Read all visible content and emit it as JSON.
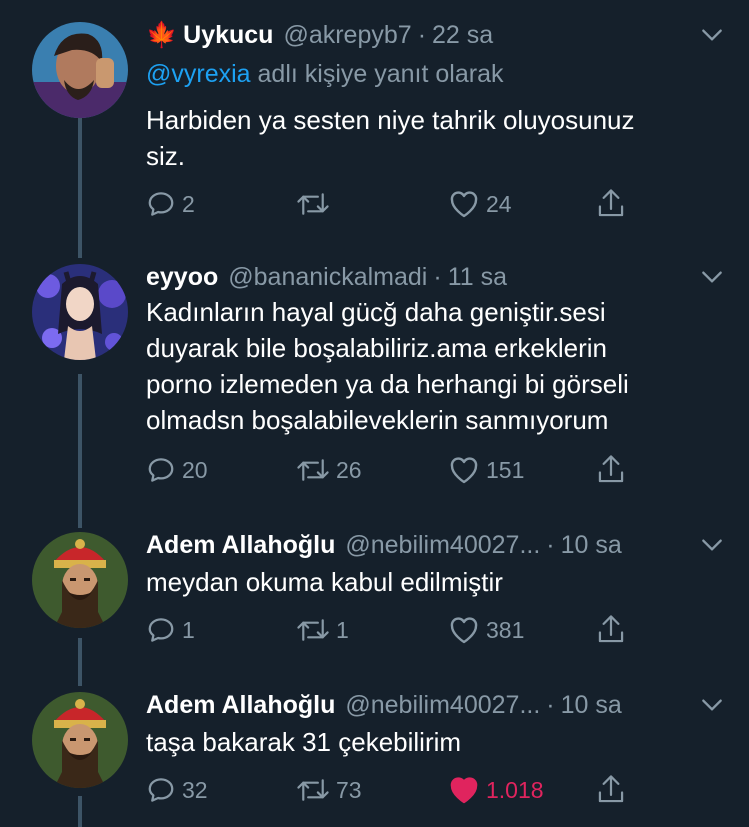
{
  "colors": {
    "background": "#15202b",
    "muted": "#8899a6",
    "link": "#1da1f2",
    "like": "#e0245e"
  },
  "tweets": [
    {
      "emoji": "🍁",
      "name": "Uykucu",
      "handle": "@akrepyb7",
      "time": "22 sa",
      "reply_to": {
        "mention": "@vyrexia",
        "suffix": " adlı kişiye yanıt olarak"
      },
      "text_lines": [
        "Harbiden ya sesten niye tahrik oluyosunuz",
        "siz."
      ],
      "replies": "2",
      "retweets": "",
      "likes": "24",
      "liked": false
    },
    {
      "name": "eyyoo",
      "handle": "@bananickalmadi",
      "time": "11 sa",
      "text_lines": [
        "Kadınların hayal gücğ daha geniştir.sesi",
        "duyarak bile boşalabiliriz.ama erkeklerin",
        "porno izlemeden ya da herhangi bi görseli",
        "olmadsn boşalabileveklerin sanmıyorum"
      ],
      "replies": "20",
      "retweets": "26",
      "likes": "151",
      "liked": false
    },
    {
      "name": "Adem Allahoğlu",
      "handle": "@nebilim40027...",
      "time": "10 sa",
      "text_lines": [
        "meydan okuma kabul edilmiştir"
      ],
      "replies": "1",
      "retweets": "1",
      "likes": "381",
      "liked": false
    },
    {
      "name": "Adem Allahoğlu",
      "handle": "@nebilim40027...",
      "time": "10 sa",
      "text_lines": [
        "taşa bakarak 31 çekebilirim"
      ],
      "replies": "32",
      "retweets": "73",
      "likes": "1.018",
      "liked": true
    }
  ],
  "separator": "·"
}
